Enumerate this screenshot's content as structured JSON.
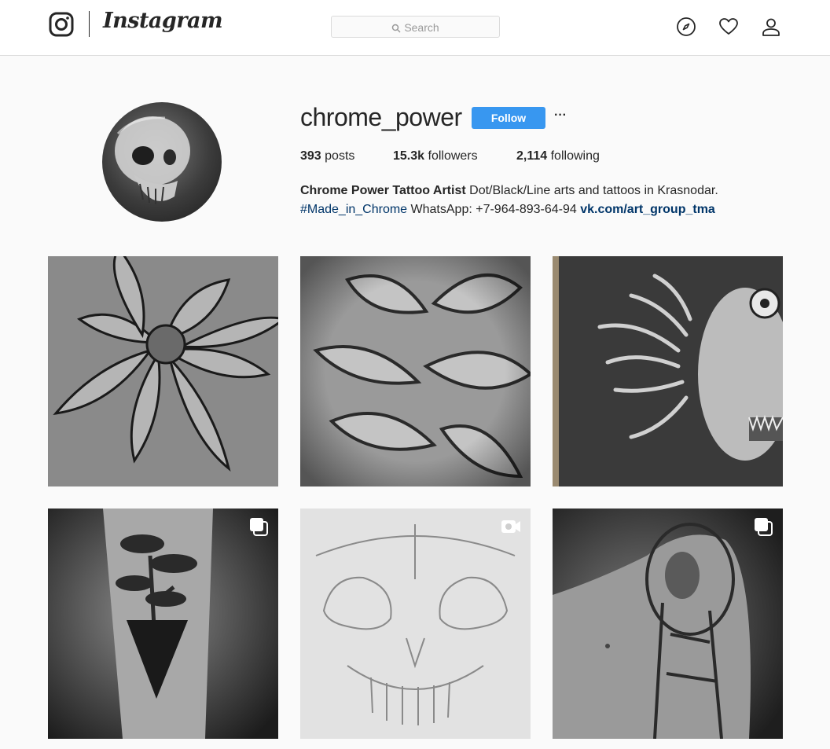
{
  "header": {
    "logo_text": "Instagram",
    "search_placeholder": "Search",
    "nav_icons": [
      "compass-icon",
      "heart-icon",
      "profile-icon"
    ]
  },
  "profile": {
    "username": "chrome_power",
    "follow_label": "Follow",
    "more_label": "···",
    "stats": {
      "posts_count": "393",
      "posts_label": "posts",
      "followers_count": "15.3k",
      "followers_label": "followers",
      "following_count": "2,114",
      "following_label": "following"
    },
    "bio": {
      "full_name": "Chrome Power Tattoo Artist",
      "line1_rest": " Dot/Black/Line arts and tattoos in Krasnodar.",
      "hashtag": "#Made_in_Chrome",
      "line2_text": " WhatsApp: +7-964-893-64-94 ",
      "website": "vk.com/art_group_tma"
    }
  },
  "colors": {
    "accent": "#3897f0",
    "link": "#003569",
    "text": "#262626",
    "border": "#dbdbdb",
    "background": "#fafafa"
  },
  "posts": [
    {
      "subject": "chrysanthemum line drawing",
      "badge": null
    },
    {
      "subject": "chrysanthemum drawing close-up",
      "badge": null
    },
    {
      "subject": "skull with flames artwork",
      "badge": null
    },
    {
      "subject": "forearm bonsai tattoo",
      "badge": "carousel-icon"
    },
    {
      "subject": "skull pencil sketch",
      "badge": "video-icon"
    },
    {
      "subject": "shoulder warrior tattoo",
      "badge": "carousel-icon"
    }
  ]
}
